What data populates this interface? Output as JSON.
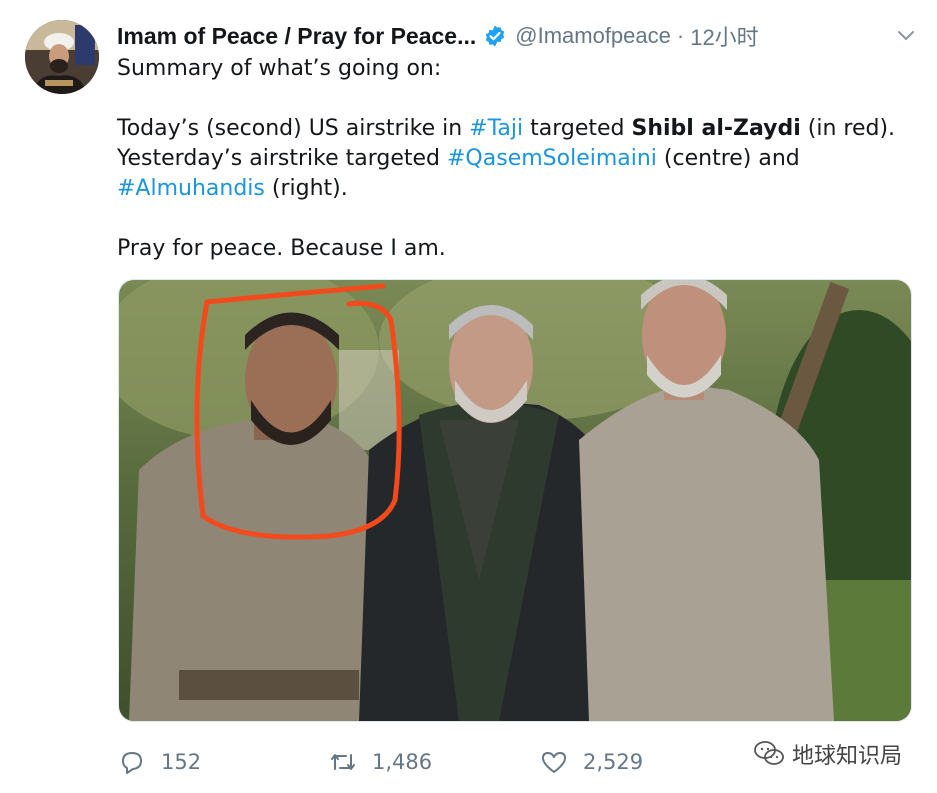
{
  "tweet": {
    "author_name": "Imam of Peace / Pray for Peace...",
    "handle": "@Imamofpeace",
    "separator": "·",
    "time": "12小时",
    "line1": "Summary of what’s going on:",
    "l2_a": "Today’s (second) US airstrike in ",
    "l2_tag": "#Taji",
    "l2_b": " targeted ",
    "l2_bold": "Shibl al-Zaydi",
    "l2_c": " (in red).",
    "l3_a": "Yesterday’s airstrike targeted ",
    "l3_tag": "#QasemSoleimaini",
    "l3_b": " (centre) and",
    "l4_tag": "#Almuhandis",
    "l4_a": " (right).",
    "line5": "Pray for peace. Because I am."
  },
  "actions": {
    "replies": "152",
    "retweets": "1,486",
    "likes": "2,529"
  },
  "watermark": "地球知识局",
  "colors": {
    "link": "#1b95e0",
    "muted": "#657786",
    "circle": "#f24a1c",
    "verified": "#1da1f2"
  }
}
